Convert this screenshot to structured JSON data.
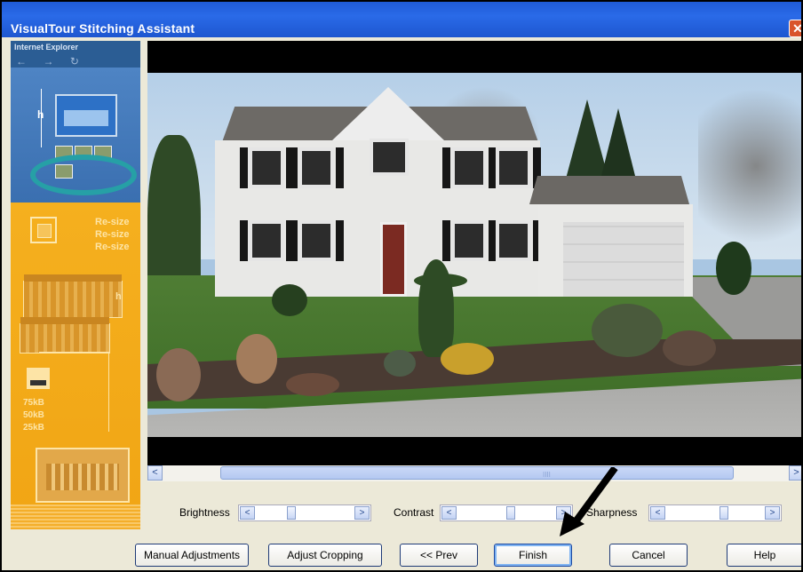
{
  "window": {
    "title": "VisualTour Stitching Assistant",
    "close_glyph": "✕"
  },
  "sidebar": {
    "browser_label": "Internet Explorer",
    "nav_glyphs": [
      "←",
      "→",
      "↻"
    ],
    "h_label": "h",
    "resize_labels": [
      "Re-size",
      "Re-size",
      "Re-size"
    ],
    "h_label_2": "h",
    "size_labels": [
      "75kB",
      "50kB",
      "25kB"
    ]
  },
  "scrollbar": {
    "left_glyph": "<",
    "right_glyph": ">",
    "grip_glyph": "IIII"
  },
  "adjustments": {
    "brightness": {
      "label": "Brightness",
      "value": 0.35
    },
    "contrast": {
      "label": "Contrast",
      "value": 0.55
    },
    "sharpness": {
      "label": "Sharpness",
      "value": 0.6
    },
    "left_glyph": "<",
    "right_glyph": ">"
  },
  "buttons": {
    "manual": "Manual Adjustments",
    "crop": "Adjust Cropping",
    "prev": "<< Prev",
    "finish": "Finish",
    "cancel": "Cancel",
    "help": "Help"
  },
  "colors": {
    "titlebar": "#1f5bd6",
    "sidebar": "#f3a91b",
    "dialog_bg": "#ece9d8",
    "arrow": "#000000"
  }
}
